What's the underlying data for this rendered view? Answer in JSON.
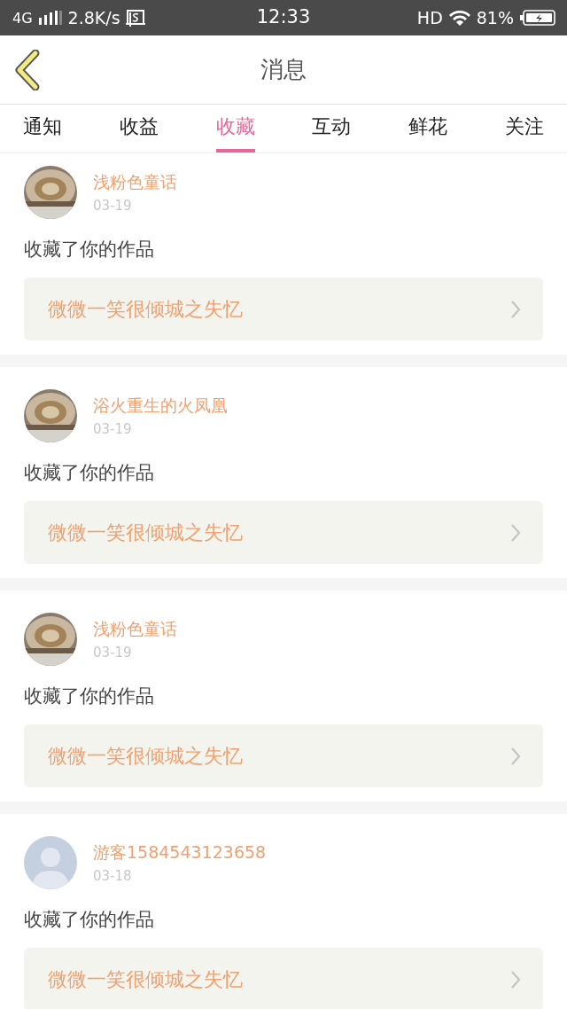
{
  "status_bar": {
    "network": "4G",
    "speed": "2.8K/s",
    "time": "12:33",
    "hd": "HD",
    "battery": "81%"
  },
  "header": {
    "title": "消息"
  },
  "tabs": [
    {
      "label": "通知",
      "selected": false
    },
    {
      "label": "收益",
      "selected": false
    },
    {
      "label": "收藏",
      "selected": true
    },
    {
      "label": "互动",
      "selected": false
    },
    {
      "label": "鲜花",
      "selected": false
    },
    {
      "label": "关注",
      "selected": false
    }
  ],
  "messages": [
    {
      "user": "浅粉色童话",
      "date": "03-19",
      "action": "收藏了你的作品",
      "work": "微微一笑很倾城之失忆"
    },
    {
      "user": "浴火重生的火凤凰",
      "date": "03-19",
      "action": "收藏了你的作品",
      "work": "微微一笑很倾城之失忆"
    },
    {
      "user": "浅粉色童话",
      "date": "03-19",
      "action": "收藏了你的作品",
      "work": "微微一笑很倾城之失忆"
    },
    {
      "avatar": {
        "kind": "default"
      },
      "user": "游客1584543123658",
      "date": "03-18",
      "action": "收藏了你的作品",
      "work": "微微一笑很倾城之失忆"
    }
  ]
}
